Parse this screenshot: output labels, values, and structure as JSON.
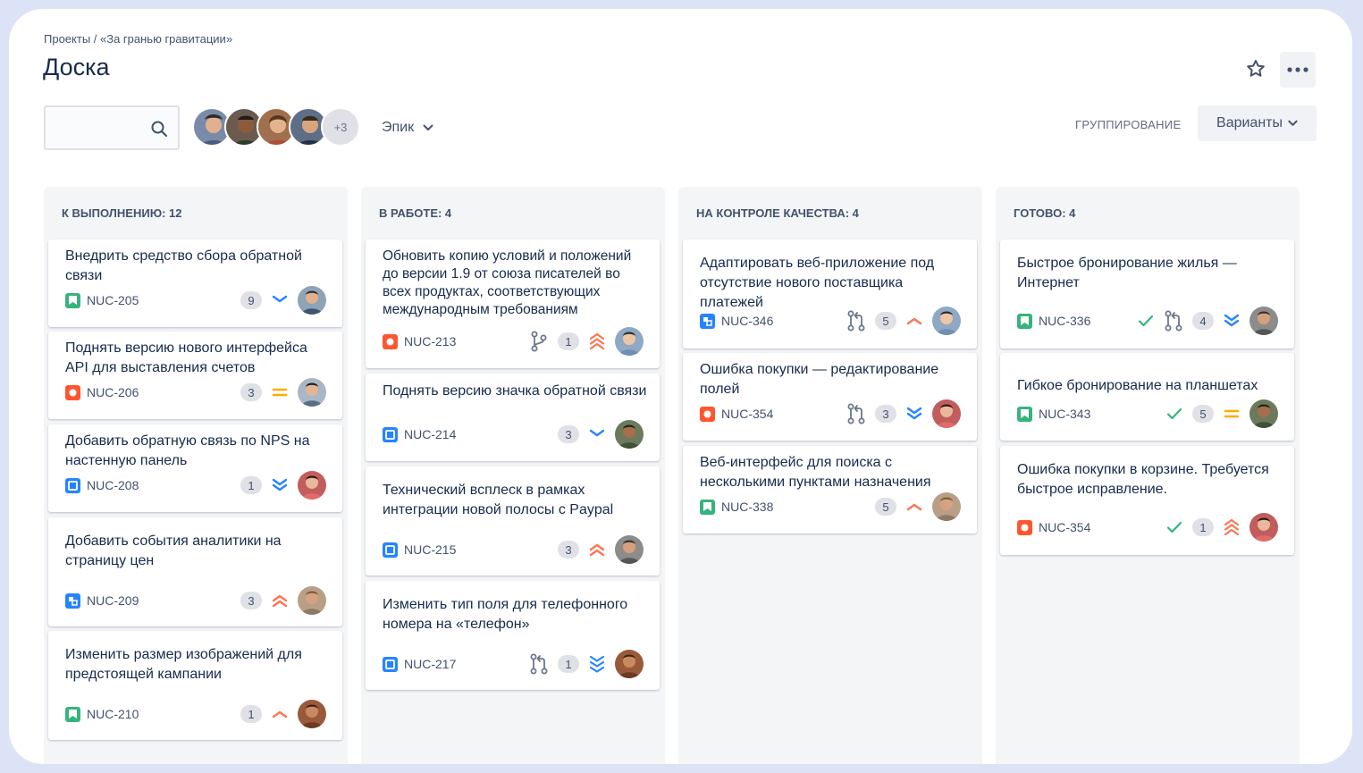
{
  "header": {
    "breadcrumb": "Проекты / «За гранью гравитации»",
    "title": "Доска"
  },
  "toolbar": {
    "search_placeholder": "",
    "avatars_more": "+3",
    "epic_label": "Эпик",
    "grouping_label": "ГРУППИРОВАНИЕ",
    "variants_label": "Варианты"
  },
  "colors": {
    "story": "#36b37e",
    "bug": "#ff5630",
    "task": "#2684ff",
    "subtask": "#2684ff",
    "priority_high": "#ff7452",
    "priority_low": "#2684ff",
    "priority_medium": "#ffab00",
    "done_check": "#36b37e"
  },
  "columns": [
    {
      "title": "К ВЫПОЛНЕНИЮ: 12",
      "cards": [
        {
          "text": "Внедрить средство сбора обратной связи",
          "key": "NUC-205",
          "type": "story",
          "count": "9",
          "priority": "low",
          "avatar": "a1"
        },
        {
          "text": "Поднять версию нового интерфейса API для выставления счетов",
          "key": "NUC-206",
          "type": "bug",
          "count": "3",
          "priority": "medium",
          "avatar": "a2"
        },
        {
          "text": "Добавить обратную связь по NPS на настенную панель",
          "key": "NUC-208",
          "type": "task",
          "count": "1",
          "priority": "lowest",
          "avatar": "a3"
        },
        {
          "text": "Добавить события аналитики на страницу цен",
          "key": "NUC-209",
          "type": "subtask",
          "count": "3",
          "priority": "highest",
          "avatar": "a4"
        },
        {
          "text": "Изменить размер изображений для предстоящей кампании",
          "key": "NUC-210",
          "type": "story",
          "count": "1",
          "priority": "high",
          "avatar": "a5"
        }
      ]
    },
    {
      "title": "В РАБОТЕ: 4",
      "cards": [
        {
          "text": "Обновить копию условий и положений до версии 1.9 от союза писателей во всех продуктах, соответствующих международным требованиям",
          "key": "NUC-213",
          "type": "bug",
          "count": "1",
          "priority": "critical",
          "avatar": "a6",
          "branch": true
        },
        {
          "text": "Поднять версию значка обратной связи",
          "key": "NUC-214",
          "type": "task",
          "count": "3",
          "priority": "low",
          "avatar": "a7"
        },
        {
          "text": "Технический всплеск в рамках интеграции новой полосы с Paypal",
          "key": "NUC-215",
          "type": "task",
          "count": "3",
          "priority": "highest",
          "avatar": "a8"
        },
        {
          "text": "Изменить тип поля для телефонного номера на «телефон»",
          "key": "NUC-217",
          "type": "task",
          "count": "1",
          "priority": "lowest3",
          "avatar": "a5",
          "pr": true
        }
      ]
    },
    {
      "title": "НА КОНТРОЛЕ КАЧЕСТВА: 4",
      "cards": [
        {
          "text": "Адаптировать веб-приложение под отсутствие нового поставщика платежей",
          "key": "NUC-346",
          "type": "subtask",
          "count": "5",
          "priority": "high",
          "avatar": "a6",
          "pr": true
        },
        {
          "text": "Ошибка покупки — редактирование полей",
          "key": "NUC-354",
          "type": "bug",
          "count": "3",
          "priority": "lowest",
          "avatar": "a3",
          "pr": true
        },
        {
          "text": "Веб-интерфейс для поиска с несколькими пунктами назначения",
          "key": "NUC-338",
          "type": "story",
          "count": "5",
          "priority": "high",
          "avatar": "a4"
        }
      ]
    },
    {
      "title": "ГОТОВО: 4",
      "cards": [
        {
          "text": "Быстрое бронирование жилья — Интернет",
          "key": "NUC-336",
          "type": "story",
          "count": "4",
          "priority": "lowest",
          "avatar": "a8",
          "check": true,
          "pr": true
        },
        {
          "text": "Гибкое бронирование на планшетах",
          "key": "NUC-343",
          "type": "story",
          "count": "5",
          "priority": "medium",
          "avatar": "a7",
          "check": true
        },
        {
          "text": "Ошибка покупки в корзине. Требуется быстрое исправление.",
          "key": "NUC-354",
          "type": "bug",
          "count": "1",
          "priority": "critical",
          "avatar": "a3",
          "check": true
        }
      ]
    }
  ]
}
